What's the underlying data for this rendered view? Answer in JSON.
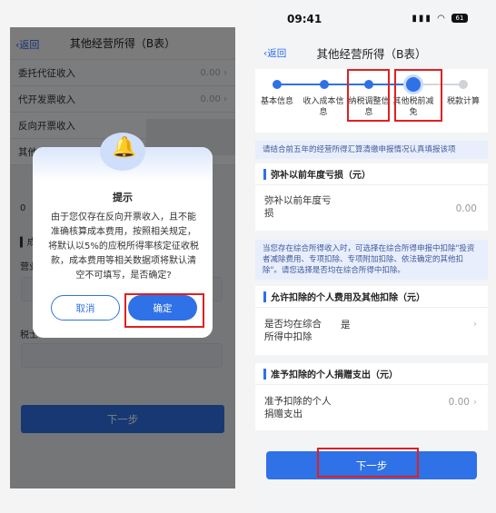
{
  "left": {
    "nav": {
      "back": "返回",
      "title": "其他经营所得（B表）"
    },
    "rows": [
      {
        "label": "委托代征收入",
        "value": "0.00"
      },
      {
        "label": "代开发票收入",
        "value": "0.00"
      },
      {
        "label": "反向开票收入",
        "value": ""
      },
      {
        "label": "其他",
        "value": ""
      }
    ],
    "zero_stub": "0",
    "section_stub": "成",
    "field_stub_1": "营业",
    "field_stub_2": "税士",
    "next_button": "下一步",
    "dialog": {
      "title": "提示",
      "message": "由于您仅存在反向开票收入，且不能准确核算成本费用，按照相关规定，将默认以5%的应税所得率核定征收税款，成本费用等相关数据项将默认清空不可填写，是否确定?",
      "cancel": "取消",
      "confirm": "确定",
      "icon": "bell-icon"
    }
  },
  "right": {
    "status": {
      "time": "09:41",
      "battery": "61"
    },
    "nav": {
      "back": "返回",
      "title": "其他经营所得（B表）"
    },
    "steps": [
      {
        "label": "基本信息",
        "state": "done"
      },
      {
        "label": "收入成本信息",
        "state": "done"
      },
      {
        "label": "纳税调整信息",
        "state": "done"
      },
      {
        "label": "其他税前减免",
        "state": "current"
      },
      {
        "label": "税款计算",
        "state": "todo"
      }
    ],
    "notice_1": "请结合前五年的经营所得汇算清缴申报情况认真填报该项",
    "section_1": {
      "title": "弥补以前年度亏损（元）"
    },
    "row_1": {
      "label": "弥补以前年度亏损",
      "value": "0.00"
    },
    "notice_2": "当您存在综合所得收入时，可选择在综合所得申报中扣除\"投资者减除费用、专项扣除、专项附加扣除、依法确定的其他扣除\"。请您选择是否均在综合所得中扣除。",
    "section_2": {
      "title": "允许扣除的个人费用及其他扣除（元）"
    },
    "row_2": {
      "label": "是否均在综合所得中扣除",
      "value": "是"
    },
    "section_3": {
      "title": "准予扣除的个人捐赠支出（元）"
    },
    "row_3": {
      "label": "准予扣除的个人捐赠支出",
      "value": "0.00"
    },
    "next_button": "下一步"
  },
  "colors": {
    "primary": "#2f71e6",
    "highlight": "#e02020"
  }
}
